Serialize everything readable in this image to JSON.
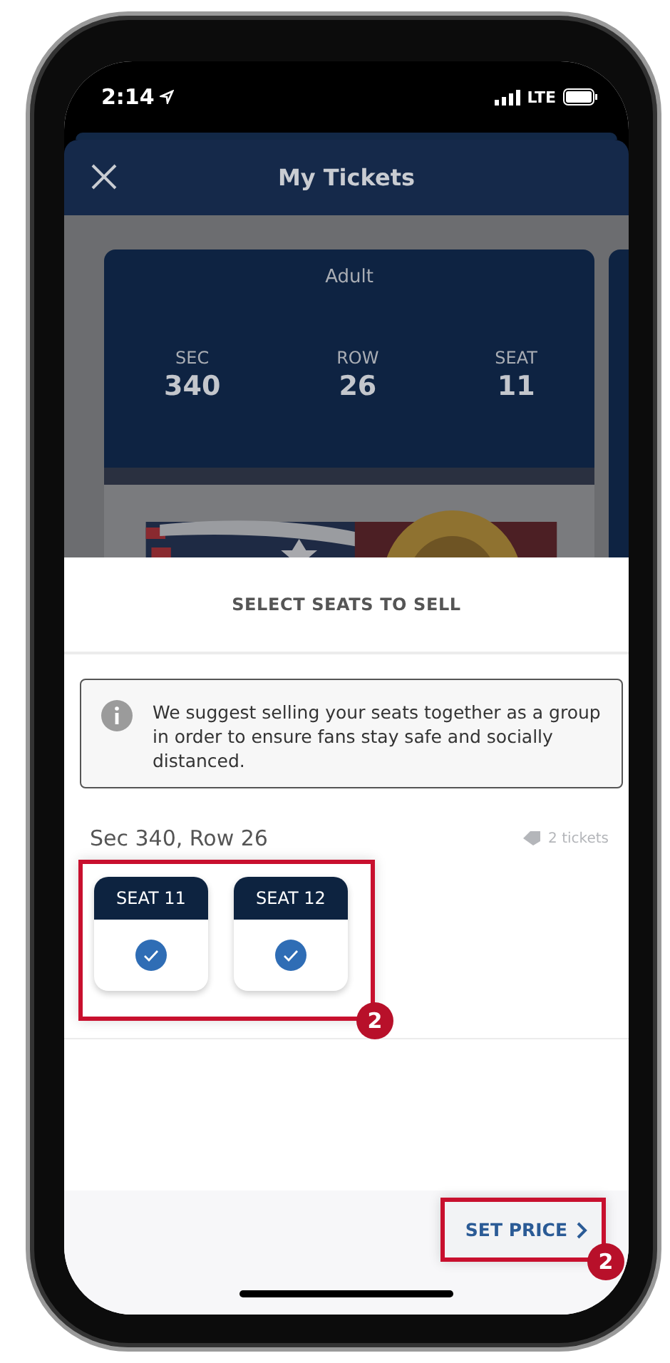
{
  "status_bar": {
    "time": "2:14",
    "network": "LTE"
  },
  "header": {
    "title": "My Tickets"
  },
  "ticket": {
    "type": "Adult",
    "fields": [
      {
        "label": "SEC",
        "value": "340"
      },
      {
        "label": "ROW",
        "value": "26"
      },
      {
        "label": "SEAT",
        "value": "11"
      }
    ]
  },
  "sheet": {
    "title": "SELECT SEATS TO SELL",
    "notice": "We suggest selling your seats together as a group in order to ensure fans stay safe and socially distanced.",
    "group": {
      "title": "Sec 340, Row 26",
      "count": "2 tickets",
      "seats": [
        {
          "label": "SEAT 11",
          "selected": true
        },
        {
          "label": "SEAT 12",
          "selected": true
        }
      ]
    }
  },
  "footer": {
    "button": "SET PRICE"
  },
  "annotations": [
    {
      "label": "2"
    },
    {
      "label": "2"
    }
  ]
}
